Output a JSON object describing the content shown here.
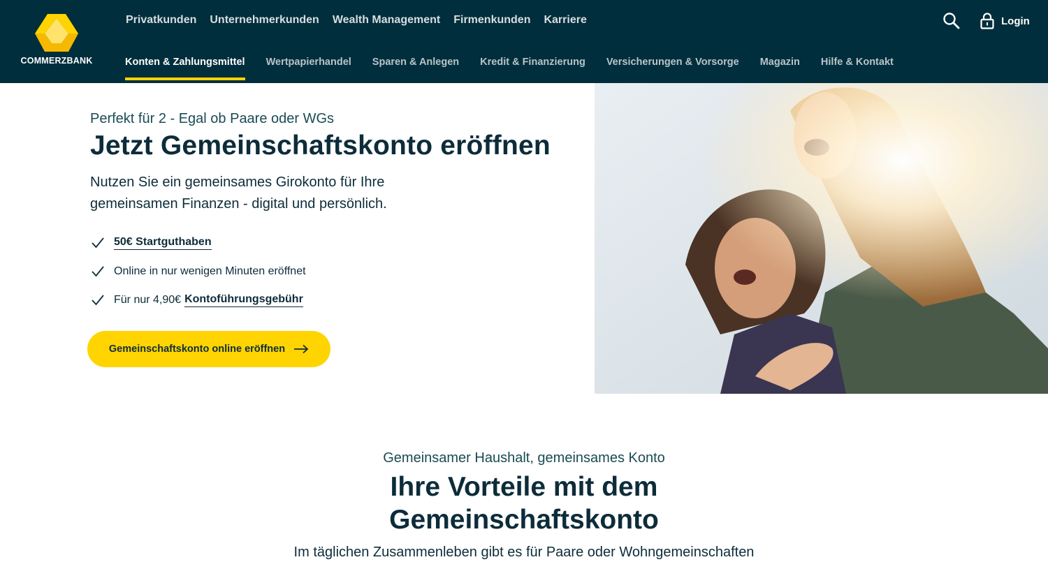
{
  "brand": {
    "name": "COMMERZBANK",
    "accent": "#ffd400",
    "navy": "#002e3c"
  },
  "topnav": [
    {
      "label": "Privatkunden"
    },
    {
      "label": "Unternehmerkunden"
    },
    {
      "label": "Wealth Management"
    },
    {
      "label": "Firmenkunden"
    },
    {
      "label": "Karriere"
    }
  ],
  "subnav": [
    {
      "label": "Konten & Zahlungsmittel",
      "active": true
    },
    {
      "label": "Wertpapierhandel"
    },
    {
      "label": "Sparen & Anlegen"
    },
    {
      "label": "Kredit & Finanzierung"
    },
    {
      "label": "Versicherungen & Vorsorge"
    },
    {
      "label": "Magazin"
    },
    {
      "label": "Hilfe & Kontakt"
    }
  ],
  "utility": {
    "search_icon": "search-icon",
    "lock_icon": "lock-icon",
    "login_label": "Login"
  },
  "hero": {
    "eyebrow": "Perfekt für 2 - Egal ob Paare oder WGs",
    "title": "Jetzt Gemeinschaftskonto eröffnen",
    "lead": "Nutzen Sie ein gemeinsames Girokonto für Ihre gemeinsamen Finanzen - digital und persönlich.",
    "benefits": [
      {
        "link": "50€ Startguthaben"
      },
      {
        "text": "Online in nur wenigen Minuten eröffnet"
      },
      {
        "text": "Für nur 4,90€",
        "link": "Kontoführungsgebühr"
      }
    ],
    "cta_label": "Gemeinschaftskonto online eröffnen"
  },
  "section": {
    "eyebrow": "Gemeinsamer Haushalt, gemeinsames Konto",
    "title": "Ihre Vorteile mit dem Gemeinschaftskonto",
    "body": "Im täglichen Zusammenleben gibt es für Paare oder Wohngemeinschaften"
  }
}
